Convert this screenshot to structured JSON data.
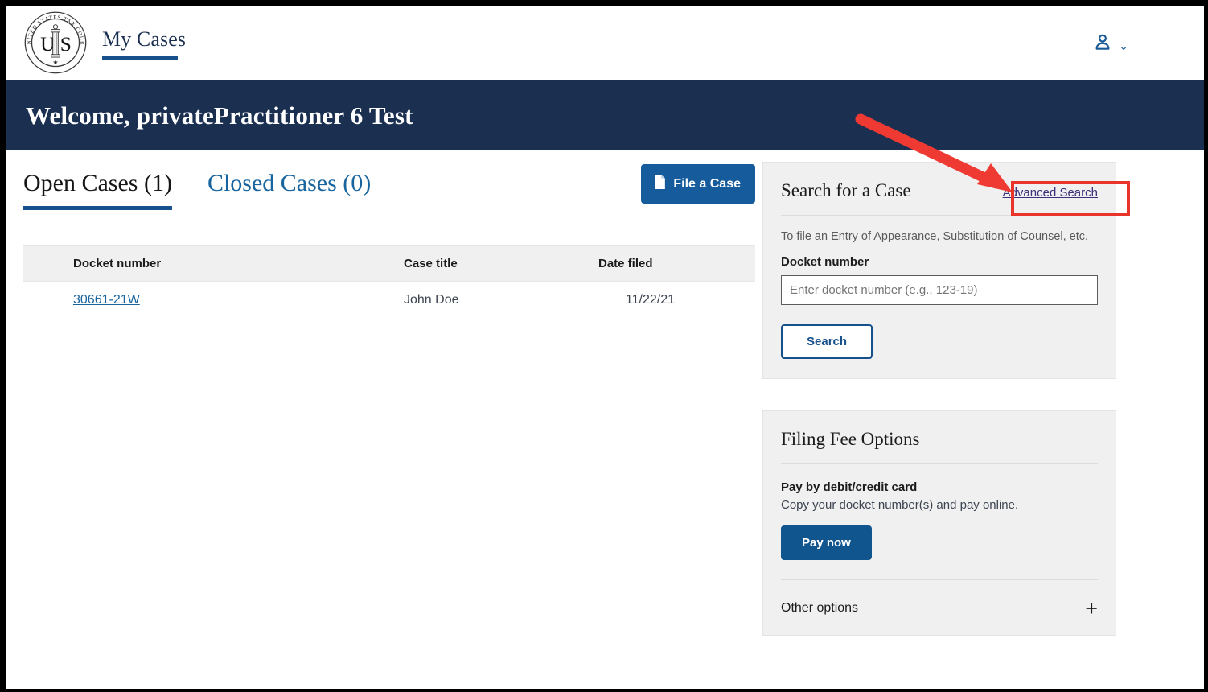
{
  "header": {
    "seal_text_top": "UNITED STATES TAX COURT",
    "seal_initials": "U S",
    "page_title": "My Cases",
    "account_icon": "user-icon",
    "account_chevron": "⌄"
  },
  "banner": {
    "welcome_text": "Welcome, privatePractitioner 6 Test"
  },
  "cases": {
    "tabs": [
      {
        "label": "Open Cases (1)",
        "active": true
      },
      {
        "label": "Closed Cases (0)",
        "active": false
      }
    ],
    "file_case_button": "File a Case",
    "file_case_icon": "document-icon",
    "table": {
      "columns": [
        "Docket number",
        "Case title",
        "Date filed"
      ],
      "rows": [
        {
          "docket_number": "30661-21W",
          "case_title": "John Doe",
          "date_filed": "11/22/21"
        }
      ]
    }
  },
  "search_card": {
    "title": "Search for a Case",
    "advanced_search_link": "Advanced Search",
    "subtitle": "To file an Entry of Appearance, Substitution of Counsel, etc.",
    "field_label": "Docket number",
    "input_value": "",
    "input_placeholder": "Enter docket number (e.g., 123-19)",
    "search_button": "Search"
  },
  "filing_fee_card": {
    "title": "Filing Fee Options",
    "pay_heading": "Pay by debit/credit card",
    "pay_description": "Copy your docket number(s) and pay online.",
    "pay_now_button": "Pay now",
    "other_options_label": "Other options",
    "other_options_icon": "plus-icon",
    "other_options_symbol": "+"
  },
  "annotations": {
    "arrow_color": "#e8342a",
    "highlight_color": "#e8342a",
    "highlight_target": "Advanced Search"
  },
  "colors": {
    "banner_navy": "#1b2f51",
    "primary_blue": "#165c9c",
    "link_blue": "#17649e",
    "visited_link_purple": "#3d2f7a",
    "card_gray": "#f0f0f0",
    "accent_underline": "#17518b"
  }
}
